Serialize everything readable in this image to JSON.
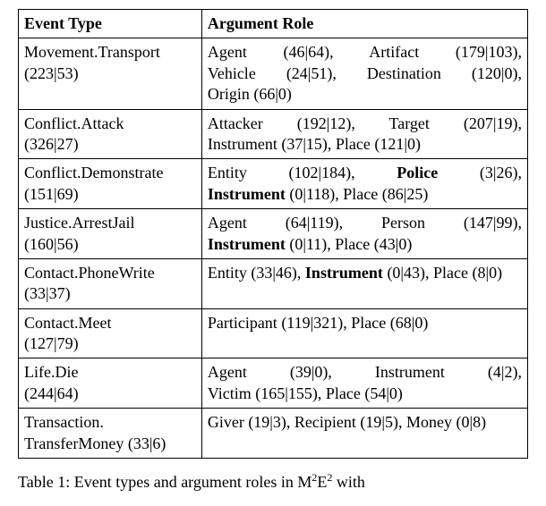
{
  "table": {
    "header": {
      "event_type": "Event Type",
      "argument_role": "Argument Role"
    },
    "rows": [
      {
        "event": {
          "name": "Movement.Transport",
          "counts": "(223|53)"
        },
        "roles": [
          {
            "label": "Agent",
            "counts": "(46|64)",
            "bold": false,
            "sep": ","
          },
          {
            "label": "Artifact",
            "counts": "(179|103)",
            "bold": false,
            "sep": ","
          },
          {
            "label": "Vehicle",
            "counts": "(24|51)",
            "bold": false,
            "sep": ","
          },
          {
            "label": "Destination",
            "counts": "(120|0)",
            "bold": false,
            "sep": ","
          },
          {
            "label": "Origin",
            "counts": "(66|0)",
            "bold": false,
            "sep": ""
          }
        ]
      },
      {
        "event": {
          "name": "Conflict.Attack",
          "counts": "(326|27)"
        },
        "roles": [
          {
            "label": "Attacker",
            "counts": "(192|12)",
            "bold": false,
            "sep": ","
          },
          {
            "label": "Target",
            "counts": "(207|19)",
            "bold": false,
            "sep": ","
          },
          {
            "label": "Instrument",
            "counts": "(37|15)",
            "bold": false,
            "sep": ","
          },
          {
            "label": "Place",
            "counts": "(121|0)",
            "bold": false,
            "sep": ""
          }
        ]
      },
      {
        "event": {
          "name": "Conflict.Demonstrate",
          "counts": "(151|69)"
        },
        "roles": [
          {
            "label": "Entity",
            "counts": "(102|184)",
            "bold": false,
            "sep": ","
          },
          {
            "label": "Police",
            "counts": "(3|26)",
            "bold": true,
            "sep": ","
          },
          {
            "label": "Instrument",
            "counts": "(0|118)",
            "bold": true,
            "sep": ","
          },
          {
            "label": "Place",
            "counts": "(86|25)",
            "bold": false,
            "sep": ""
          }
        ]
      },
      {
        "event": {
          "name": "Justice.ArrestJail",
          "counts": "(160|56)"
        },
        "roles": [
          {
            "label": "Agent",
            "counts": "(64|119)",
            "bold": false,
            "sep": ","
          },
          {
            "label": "Person",
            "counts": "(147|99)",
            "bold": false,
            "sep": ","
          },
          {
            "label": "Instrument",
            "counts": "(0|11)",
            "bold": true,
            "sep": ","
          },
          {
            "label": "Place",
            "counts": "(43|0)",
            "bold": false,
            "sep": ""
          }
        ]
      },
      {
        "event": {
          "name": "Contact.PhoneWrite",
          "counts": "(33|37)"
        },
        "roles": [
          {
            "label": "Entity",
            "counts": "(33|46)",
            "bold": false,
            "sep": ","
          },
          {
            "label": "Instrument",
            "counts": "(0|43)",
            "bold": true,
            "sep": ","
          },
          {
            "label": "Place",
            "counts": "(8|0)",
            "bold": false,
            "sep": ""
          }
        ]
      },
      {
        "event": {
          "name": "Contact.Meet",
          "counts": "(127|79)"
        },
        "roles": [
          {
            "label": "Participant",
            "counts": "(119|321)",
            "bold": false,
            "sep": ","
          },
          {
            "label": "Place",
            "counts": "(68|0)",
            "bold": false,
            "sep": ""
          }
        ]
      },
      {
        "event": {
          "name": "Life.Die",
          "counts": "(244|64)"
        },
        "roles": [
          {
            "label": "Agent",
            "counts": "(39|0)",
            "bold": false,
            "sep": ","
          },
          {
            "label": "Instrument",
            "counts": "(4|2)",
            "bold": false,
            "sep": ","
          },
          {
            "label": "Victim",
            "counts": "(165|155)",
            "bold": false,
            "sep": ","
          },
          {
            "label": "Place",
            "counts": "(54|0)",
            "bold": false,
            "sep": ""
          }
        ]
      },
      {
        "event": {
          "name_line1": "Transaction.",
          "name_line2": "TransferMoney",
          "counts": "(33|6)"
        },
        "roles": [
          {
            "label": "Giver",
            "counts": "(19|3)",
            "bold": false,
            "sep": ","
          },
          {
            "label": "Recipient",
            "counts": "(19|5)",
            "bold": false,
            "sep": ","
          },
          {
            "label": "Money",
            "counts": "(0|8)",
            "bold": false,
            "sep": ""
          }
        ]
      }
    ]
  },
  "caption": {
    "prefix": "Table 1: Event types and argument roles in M",
    "sup1": "2",
    "mid1": "E",
    "sup2": "2",
    "suffix": " with"
  }
}
